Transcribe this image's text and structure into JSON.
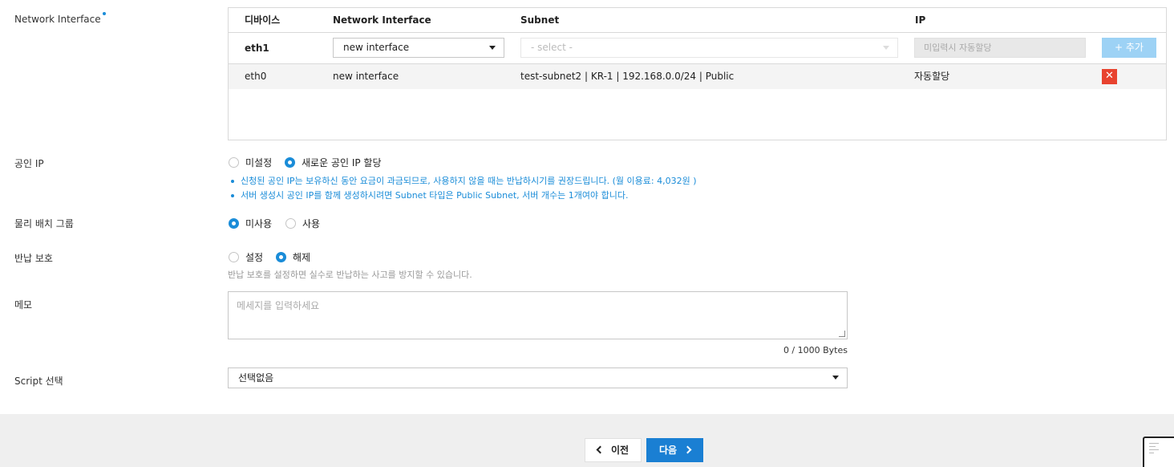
{
  "network_interface": {
    "label": "Network Interface",
    "columns": [
      "디바이스",
      "Network Interface",
      "Subnet",
      "IP"
    ],
    "edit_row": {
      "device": "eth1",
      "interface_value": "new interface",
      "subnet_placeholder": "- select -",
      "ip_placeholder": "미입력시 자동할당",
      "add_label": "+ 추가"
    },
    "rows": [
      {
        "device": "eth0",
        "interface": "new interface",
        "subnet": "test-subnet2 | KR-1 | 192.168.0.0/24 | Public",
        "ip": "자동할당",
        "delete_label": "✕"
      }
    ]
  },
  "public_ip": {
    "label": "공인 IP",
    "options": [
      "미설정",
      "새로운 공인 IP 할당"
    ],
    "selected": 1,
    "notes": [
      "신청된 공인 IP는 보유하신 동안 요금이 과금되므로, 사용하지 않을 때는 반납하시기를 권장드립니다. (월 이용료: 4,032원 )",
      "서버 생성시 공인 IP를 함께 생성하시려면 Subnet 타입은 Public Subnet, 서버 개수는 1개여야 합니다."
    ]
  },
  "placement_group": {
    "label": "물리 배치 그룹",
    "options": [
      "미사용",
      "사용"
    ],
    "selected": 0
  },
  "return_protection": {
    "label": "반납 보호",
    "options": [
      "설정",
      "해제"
    ],
    "selected": 1,
    "hint": "반납 보호를 설정하면 실수로 반납하는 사고를 방지할 수 있습니다."
  },
  "memo": {
    "label": "메모",
    "placeholder": "메세지를 입력하세요",
    "counter": "0 / 1000 Bytes"
  },
  "script": {
    "label": "Script 선택",
    "value": "선택없음"
  },
  "footer": {
    "prev_label": "이전",
    "next_label": "다음"
  },
  "colors": {
    "accent": "#1a8cd8",
    "primary_button": "#1a7fd3",
    "delete": "#e8432f",
    "add_disabled": "#9dd2f5"
  }
}
